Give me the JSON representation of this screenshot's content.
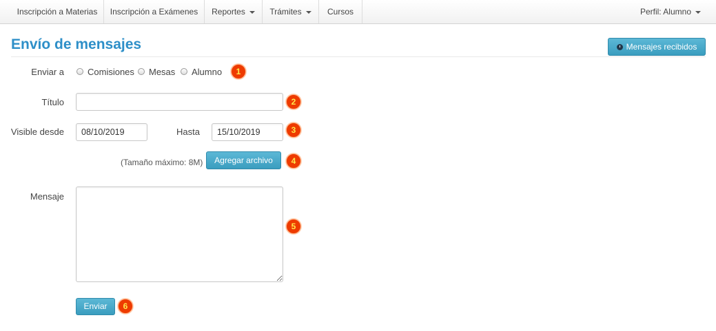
{
  "navbar": {
    "items": [
      {
        "label": "Inscripción a Materias"
      },
      {
        "label": "Inscripción a Exámenes"
      },
      {
        "label": "Reportes"
      },
      {
        "label": "Trámites"
      },
      {
        "label": "Cursos"
      }
    ],
    "profile_label": "Perfil: Alumno"
  },
  "header": {
    "title": "Envío de mensajes",
    "received_button": "Mensajes recibidos"
  },
  "form": {
    "send_to_label": "Enviar a",
    "send_to_options": [
      "Comisiones",
      "Mesas",
      "Alumno"
    ],
    "title_label": "Título",
    "title_value": "",
    "visible_from_label": "Visible desde",
    "visible_from_value": "08/10/2019",
    "until_label": "Hasta",
    "until_value": "15/10/2019",
    "max_size_hint": "(Tamaño máximo: 8M)",
    "add_file_button": "Agregar archivo",
    "message_label": "Mensaje",
    "message_value": "",
    "send_button": "Enviar"
  },
  "badges": [
    "1",
    "2",
    "3",
    "4",
    "5",
    "6"
  ],
  "colors": {
    "title": "#2e8fc8",
    "button": "#3a9dbf",
    "badge": "#ee3b00",
    "badge_text": "#ffe94d"
  }
}
